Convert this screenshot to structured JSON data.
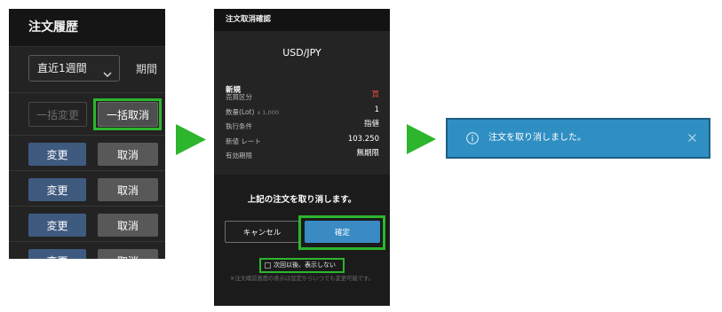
{
  "colors": {
    "highlight_green": "#2db52d",
    "confirm_blue": "#3a8bc4",
    "edit_blue": "#3f5a7f",
    "buy_red": "#e24a3f",
    "info_blue": "#2f8fc3",
    "info_border": "#1d5f86"
  },
  "step_arrows": [
    {
      "icon": "arrow-right-icon"
    },
    {
      "icon": "arrow-right-icon"
    }
  ],
  "history_panel": {
    "title": "注文履歴",
    "period_select": {
      "value": "直近1週間",
      "icon": "chevron-down-icon"
    },
    "period_label": "期間",
    "bulk_change_label": "一括変更",
    "bulk_change_enabled": false,
    "bulk_cancel_label": "一括取消",
    "rows": [
      {
        "change_label": "変更",
        "cancel_label": "取消"
      },
      {
        "change_label": "変更",
        "cancel_label": "取消"
      },
      {
        "change_label": "変更",
        "cancel_label": "取消"
      },
      {
        "change_label": "変更",
        "cancel_label": "取消"
      }
    ]
  },
  "cancel_dialog": {
    "title": "注文取消確認",
    "symbol": "USD/JPY",
    "order_type": "新規",
    "details": [
      {
        "label": "売買区分",
        "value": "買"
      },
      {
        "label": "数量(Lot)",
        "suffix": "x 1,000",
        "value": "1"
      },
      {
        "label": "執行条件",
        "value": "指値"
      },
      {
        "label": "新値 レート",
        "value": "103.250"
      },
      {
        "label": "有効期限",
        "value": "無期限"
      }
    ],
    "message": "上記の注文を取り消します。",
    "cancel_label": "キャンセル",
    "confirm_label": "確定",
    "dont_show_label": "次回以後、表示しない",
    "dont_show_checked": false,
    "note": "※注文確認画面の表示は設定からいつでも変更可能です。"
  },
  "notification": {
    "icon": "info-icon",
    "message": "注文を取り消しました。",
    "close_icon": "close-icon"
  }
}
